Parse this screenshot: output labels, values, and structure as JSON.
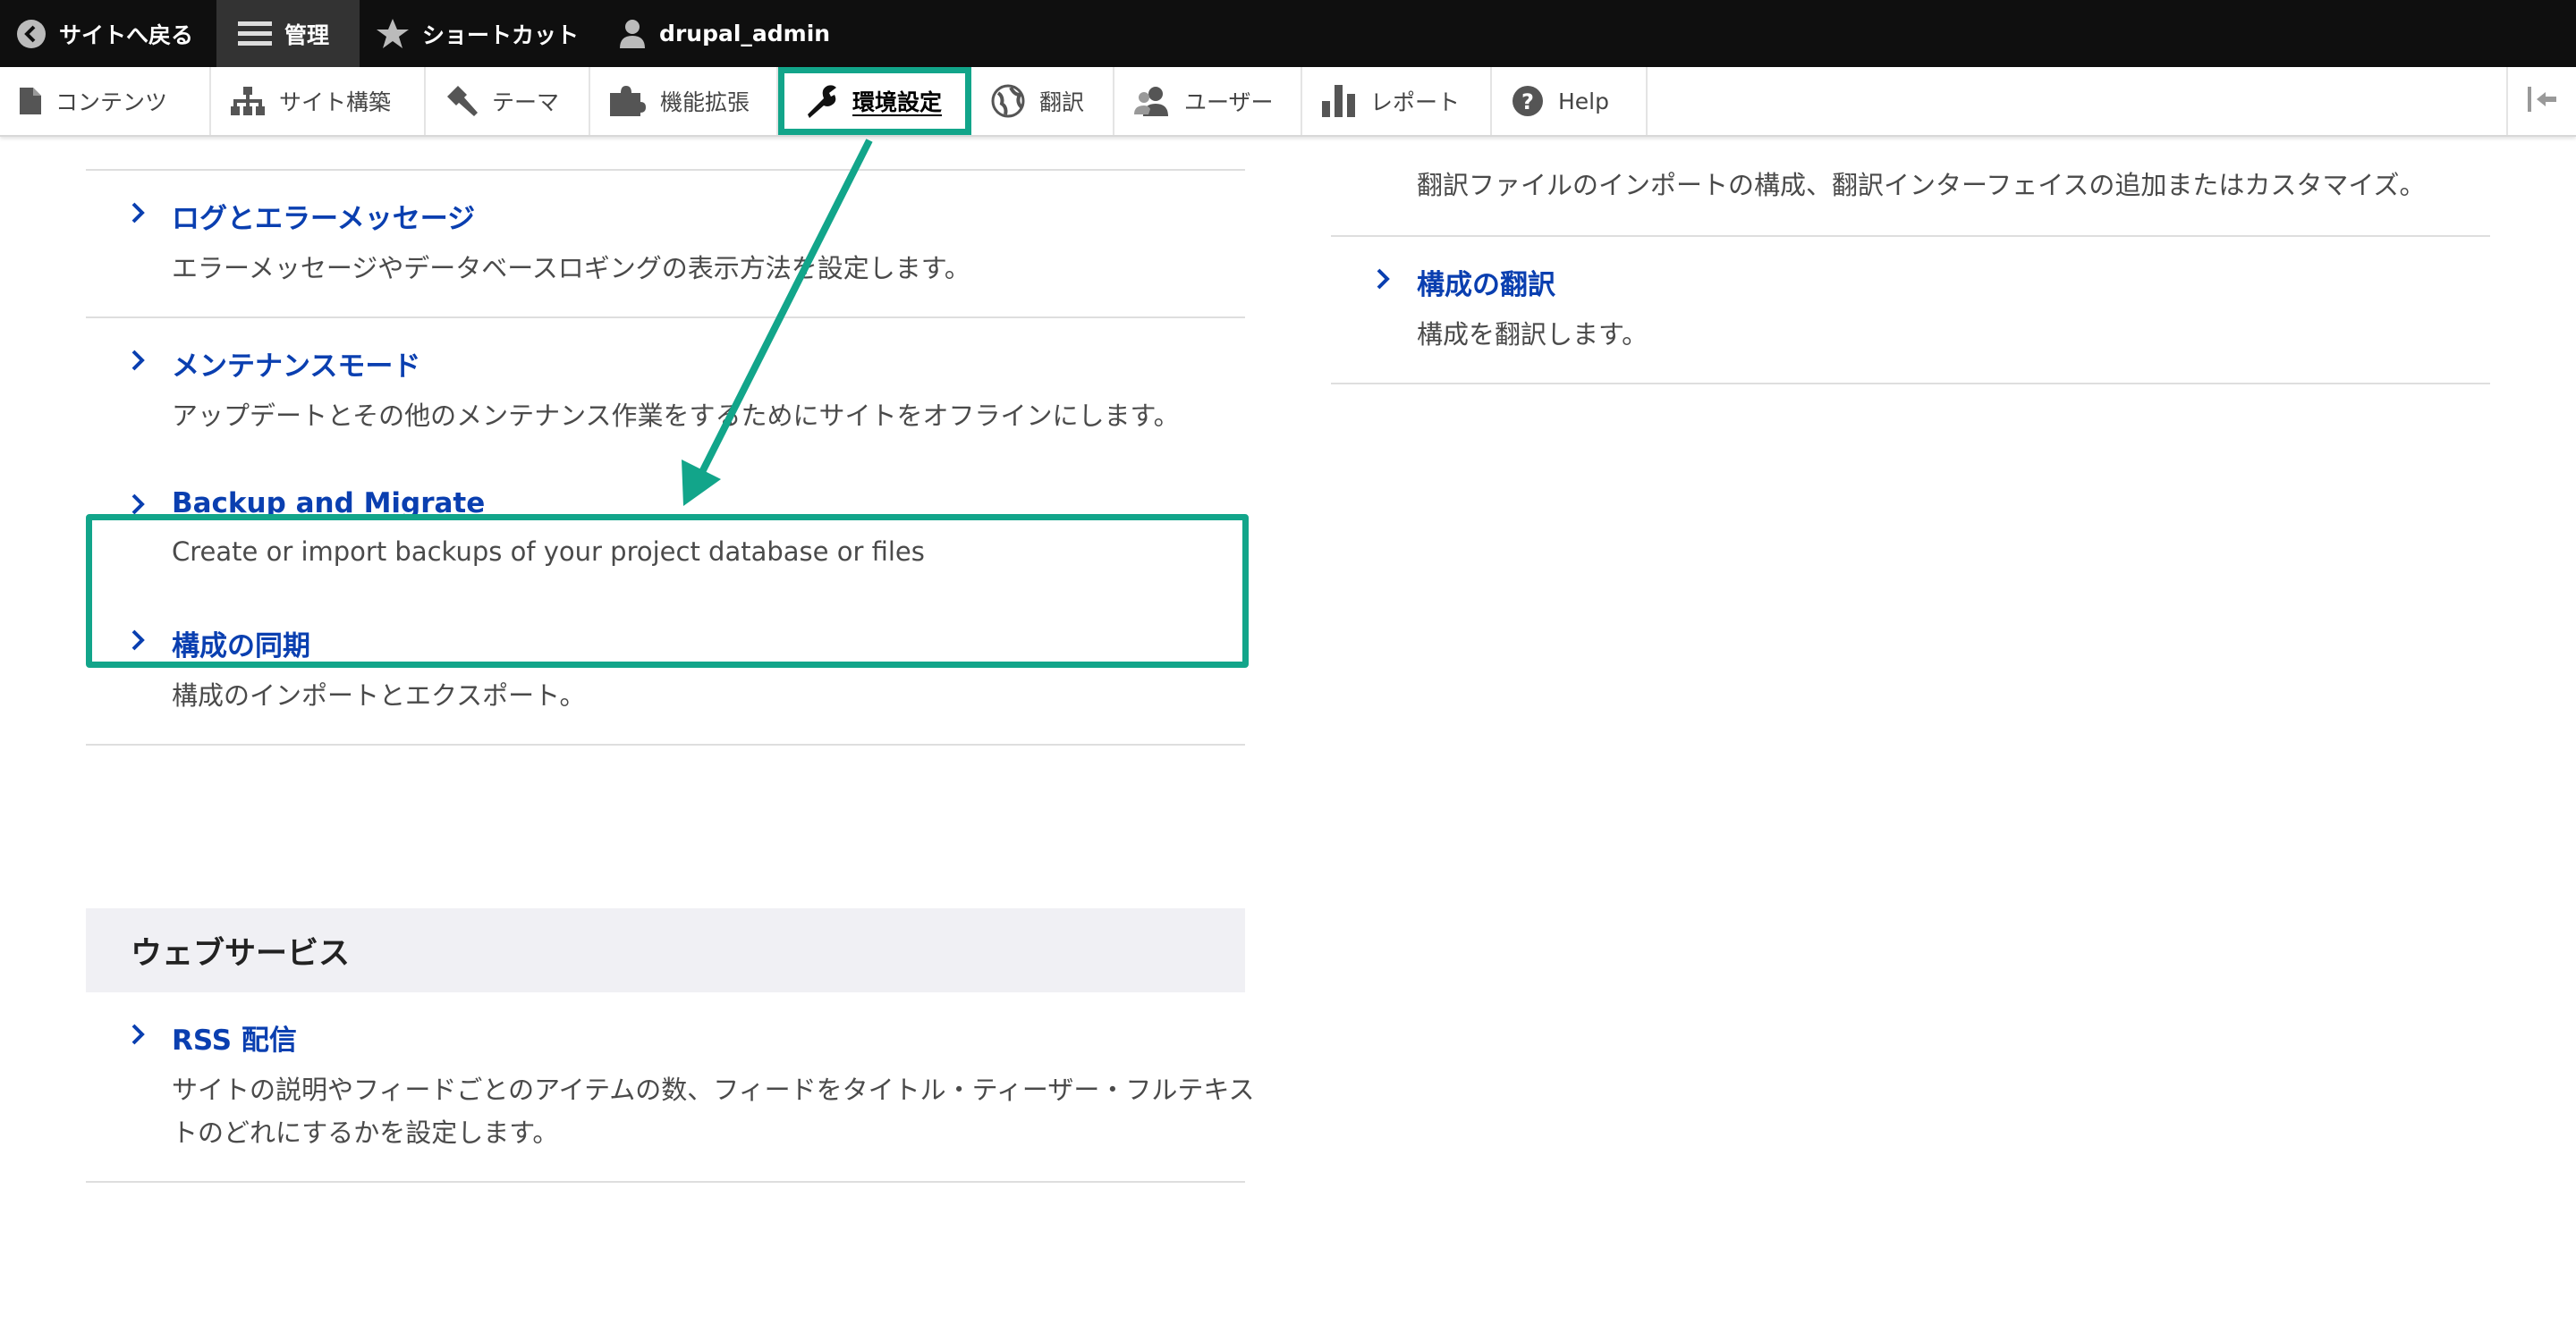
{
  "toolbar": {
    "back_label": "サイトへ戻る",
    "manage_label": "管理",
    "shortcuts_label": "ショートカット",
    "user_label": "drupal_admin"
  },
  "tray": {
    "items": [
      {
        "label": "コンテンツ",
        "icon": "file-icon"
      },
      {
        "label": "サイト構築",
        "icon": "sitemap-icon"
      },
      {
        "label": "テーマ",
        "icon": "paintbrush-icon"
      },
      {
        "label": "機能拡張",
        "icon": "puzzle-icon"
      },
      {
        "label": "環境設定",
        "icon": "wrench-icon"
      },
      {
        "label": "翻訳",
        "icon": "globe-icon"
      },
      {
        "label": "ユーザー",
        "icon": "users-icon"
      },
      {
        "label": "レポート",
        "icon": "bar-chart-icon"
      },
      {
        "label": "Help",
        "icon": "help-icon"
      }
    ],
    "active": "環境設定"
  },
  "left": {
    "items": [
      {
        "title": "ログとエラーメッセージ",
        "desc": "エラーメッセージやデータベースロギングの表示方法を設定します。"
      },
      {
        "title": "メンテナンスモード",
        "desc": "アップデートとその他のメンテナンス作業をするためにサイトをオフラインにします。"
      },
      {
        "title": "Backup and Migrate",
        "desc": "Create or import backups of your project database or files"
      },
      {
        "title": "構成の同期",
        "desc": "構成のインポートとエクスポート。"
      }
    ],
    "section2": {
      "title": "ウェブサービス",
      "items": [
        {
          "title": "RSS 配信",
          "desc": "サイトの説明やフィードごとのアイテムの数、フィードをタイトル・ティーザー・フルテキストのどれにするかを設定します。"
        }
      ]
    }
  },
  "right": {
    "partial_desc": "翻訳ファイルのインポートの構成、翻訳インターフェイスの追加またはカスタマイズ。",
    "items": [
      {
        "title": "構成の翻訳",
        "desc": "構成を翻訳します。"
      }
    ]
  },
  "colors": {
    "accent": "#12a58a",
    "link": "#0a3fb0",
    "toolbar_bg": "#0f0f0f"
  }
}
